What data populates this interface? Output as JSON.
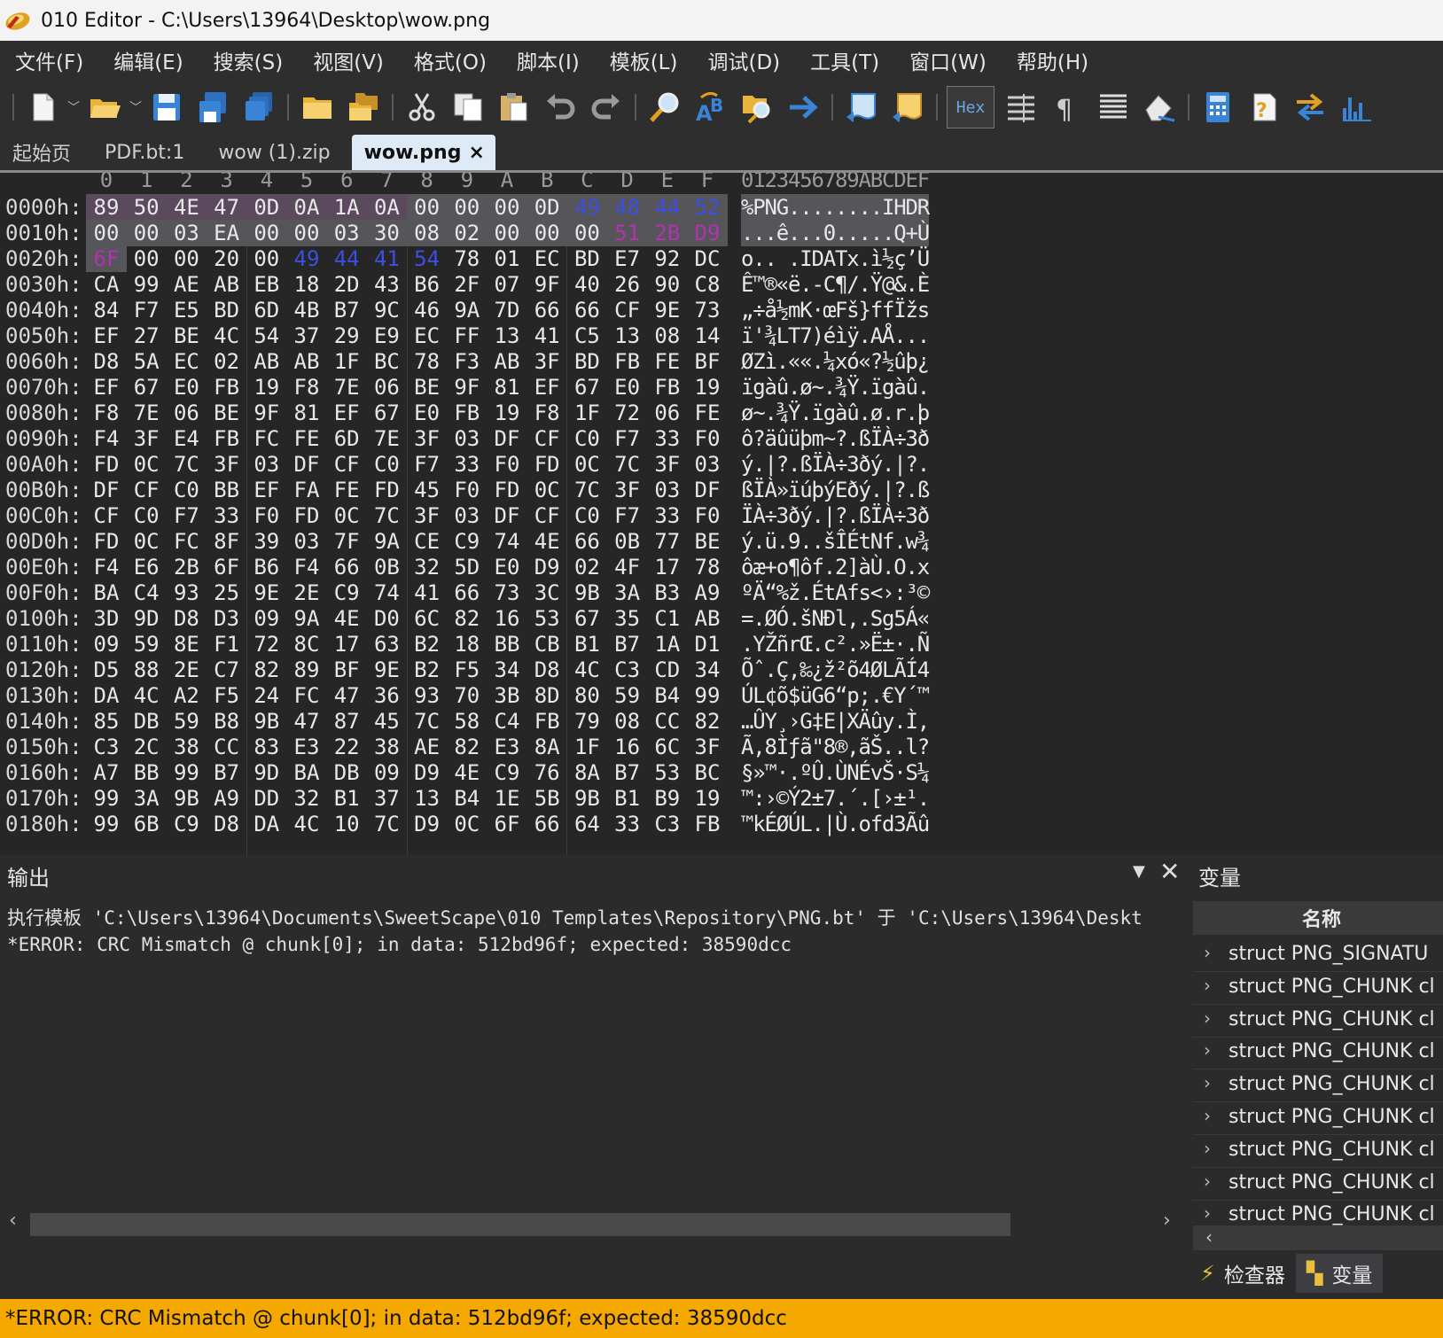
{
  "window": {
    "title": "010 Editor - C:\\Users\\13964\\Desktop\\wow.png"
  },
  "menu": [
    "文件(F)",
    "编辑(E)",
    "搜索(S)",
    "视图(V)",
    "格式(O)",
    "脚本(I)",
    "模板(L)",
    "调试(D)",
    "工具(T)",
    "窗口(W)",
    "帮助(H)"
  ],
  "toolbar": {
    "hex_label": "Hex"
  },
  "tabs": [
    {
      "label": "起始页",
      "active": false
    },
    {
      "label": "PDF.bt:1",
      "active": false
    },
    {
      "label": "wow (1).zip",
      "active": false
    },
    {
      "label": "wow.png",
      "active": true,
      "close": "×"
    }
  ],
  "hex": {
    "column_labels": [
      "0",
      "1",
      "2",
      "3",
      "4",
      "5",
      "6",
      "7",
      "8",
      "9",
      "A",
      "B",
      "C",
      "D",
      "E",
      "F"
    ],
    "ascii_header": "0123456789ABCDEF",
    "rows": [
      {
        "addr": "0000h:",
        "bytes": [
          "89",
          "50",
          "4E",
          "47",
          "0D",
          "0A",
          "1A",
          "0A",
          "00",
          "00",
          "00",
          "0D",
          "49",
          "48",
          "44",
          "52"
        ],
        "ascii": "%PNG........IHDR"
      },
      {
        "addr": "0010h:",
        "bytes": [
          "00",
          "00",
          "03",
          "EA",
          "00",
          "00",
          "03",
          "30",
          "08",
          "02",
          "00",
          "00",
          "00",
          "51",
          "2B",
          "D9"
        ],
        "ascii": "...ê...0.....Q+Ù"
      },
      {
        "addr": "0020h:",
        "bytes": [
          "6F",
          "00",
          "00",
          "20",
          "00",
          "49",
          "44",
          "41",
          "54",
          "78",
          "01",
          "EC",
          "BD",
          "E7",
          "92",
          "DC"
        ],
        "ascii": "o.. .IDATx.ì½ç’Ü"
      },
      {
        "addr": "0030h:",
        "bytes": [
          "CA",
          "99",
          "AE",
          "AB",
          "EB",
          "18",
          "2D",
          "43",
          "B6",
          "2F",
          "07",
          "9F",
          "40",
          "26",
          "90",
          "C8"
        ],
        "ascii": "Ê™®«ë.-C¶/.Ÿ@&.È"
      },
      {
        "addr": "0040h:",
        "bytes": [
          "84",
          "F7",
          "E5",
          "BD",
          "6D",
          "4B",
          "B7",
          "9C",
          "46",
          "9A",
          "7D",
          "66",
          "66",
          "CF",
          "9E",
          "73"
        ],
        "ascii": "„÷å½mK·œFš}ffÏžs"
      },
      {
        "addr": "0050h:",
        "bytes": [
          "EF",
          "27",
          "BE",
          "4C",
          "54",
          "37",
          "29",
          "E9",
          "EC",
          "FF",
          "13",
          "41",
          "C5",
          "13",
          "08",
          "14"
        ],
        "ascii": "ï'¾LT7)éìÿ.AÅ..."
      },
      {
        "addr": "0060h:",
        "bytes": [
          "D8",
          "5A",
          "EC",
          "02",
          "AB",
          "AB",
          "1F",
          "BC",
          "78",
          "F3",
          "AB",
          "3F",
          "BD",
          "FB",
          "FE",
          "BF"
        ],
        "ascii": "ØZì.««.¼xó«?½ûþ¿"
      },
      {
        "addr": "0070h:",
        "bytes": [
          "EF",
          "67",
          "E0",
          "FB",
          "19",
          "F8",
          "7E",
          "06",
          "BE",
          "9F",
          "81",
          "EF",
          "67",
          "E0",
          "FB",
          "19"
        ],
        "ascii": "ïgàû.ø~.¾Ÿ.ïgàû."
      },
      {
        "addr": "0080h:",
        "bytes": [
          "F8",
          "7E",
          "06",
          "BE",
          "9F",
          "81",
          "EF",
          "67",
          "E0",
          "FB",
          "19",
          "F8",
          "1F",
          "72",
          "06",
          "FE"
        ],
        "ascii": "ø~.¾Ÿ.ïgàû.ø.r.þ"
      },
      {
        "addr": "0090h:",
        "bytes": [
          "F4",
          "3F",
          "E4",
          "FB",
          "FC",
          "FE",
          "6D",
          "7E",
          "3F",
          "03",
          "DF",
          "CF",
          "C0",
          "F7",
          "33",
          "F0"
        ],
        "ascii": "ô?äûüþm~?.ßÏÀ÷3ð"
      },
      {
        "addr": "00A0h:",
        "bytes": [
          "FD",
          "0C",
          "7C",
          "3F",
          "03",
          "DF",
          "CF",
          "C0",
          "F7",
          "33",
          "F0",
          "FD",
          "0C",
          "7C",
          "3F",
          "03"
        ],
        "ascii": "ý.|?.ßÏÀ÷3ðý.|?."
      },
      {
        "addr": "00B0h:",
        "bytes": [
          "DF",
          "CF",
          "C0",
          "BB",
          "EF",
          "FA",
          "FE",
          "FD",
          "45",
          "F0",
          "FD",
          "0C",
          "7C",
          "3F",
          "03",
          "DF"
        ],
        "ascii": "ßÏÀ»ïúþýEðý.|?.ß"
      },
      {
        "addr": "00C0h:",
        "bytes": [
          "CF",
          "C0",
          "F7",
          "33",
          "F0",
          "FD",
          "0C",
          "7C",
          "3F",
          "03",
          "DF",
          "CF",
          "C0",
          "F7",
          "33",
          "F0"
        ],
        "ascii": "ÏÀ÷3ðý.|?.ßÏÀ÷3ð"
      },
      {
        "addr": "00D0h:",
        "bytes": [
          "FD",
          "0C",
          "FC",
          "8F",
          "39",
          "03",
          "7F",
          "9A",
          "CE",
          "C9",
          "74",
          "4E",
          "66",
          "0B",
          "77",
          "BE"
        ],
        "ascii": "ý.ü.9..šÎÉtNf.w¾"
      },
      {
        "addr": "00E0h:",
        "bytes": [
          "F4",
          "E6",
          "2B",
          "6F",
          "B6",
          "F4",
          "66",
          "0B",
          "32",
          "5D",
          "E0",
          "D9",
          "02",
          "4F",
          "17",
          "78"
        ],
        "ascii": "ôæ+o¶ôf.2]àÙ.O.x"
      },
      {
        "addr": "00F0h:",
        "bytes": [
          "BA",
          "C4",
          "93",
          "25",
          "9E",
          "2E",
          "C9",
          "74",
          "41",
          "66",
          "73",
          "3C",
          "9B",
          "3A",
          "B3",
          "A9"
        ],
        "ascii": "ºÄ“%ž.ÉtAfs<›:³©"
      },
      {
        "addr": "0100h:",
        "bytes": [
          "3D",
          "9D",
          "D8",
          "D3",
          "09",
          "9A",
          "4E",
          "D0",
          "6C",
          "82",
          "16",
          "53",
          "67",
          "35",
          "C1",
          "AB"
        ],
        "ascii": "=.ØÓ.šNÐl‚.Sg5Á«"
      },
      {
        "addr": "0110h:",
        "bytes": [
          "09",
          "59",
          "8E",
          "F1",
          "72",
          "8C",
          "17",
          "63",
          "B2",
          "18",
          "BB",
          "CB",
          "B1",
          "B7",
          "1A",
          "D1"
        ],
        "ascii": ".YŽñrŒ.c².»Ë±·.Ñ"
      },
      {
        "addr": "0120h:",
        "bytes": [
          "D5",
          "88",
          "2E",
          "C7",
          "82",
          "89",
          "BF",
          "9E",
          "B2",
          "F5",
          "34",
          "D8",
          "4C",
          "C3",
          "CD",
          "34"
        ],
        "ascii": "Õˆ.Ç‚‰¿ž²õ4ØLÃÍ4"
      },
      {
        "addr": "0130h:",
        "bytes": [
          "DA",
          "4C",
          "A2",
          "F5",
          "24",
          "FC",
          "47",
          "36",
          "93",
          "70",
          "3B",
          "8D",
          "80",
          "59",
          "B4",
          "99"
        ],
        "ascii": "ÚL¢õ$üG6“p;.€Y´™"
      },
      {
        "addr": "0140h:",
        "bytes": [
          "85",
          "DB",
          "59",
          "B8",
          "9B",
          "47",
          "87",
          "45",
          "7C",
          "58",
          "C4",
          "FB",
          "79",
          "08",
          "CC",
          "82"
        ],
        "ascii": "…ÛY¸›G‡E|XÄûy.Ì‚"
      },
      {
        "addr": "0150h:",
        "bytes": [
          "C3",
          "2C",
          "38",
          "CC",
          "83",
          "E3",
          "22",
          "38",
          "AE",
          "82",
          "E3",
          "8A",
          "1F",
          "16",
          "6C",
          "3F"
        ],
        "ascii": "Ã,8Ìƒã\"8®‚ãŠ..l?"
      },
      {
        "addr": "0160h:",
        "bytes": [
          "A7",
          "BB",
          "99",
          "B7",
          "9D",
          "BA",
          "DB",
          "09",
          "D9",
          "4E",
          "C9",
          "76",
          "8A",
          "B7",
          "53",
          "BC"
        ],
        "ascii": "§»™·.ºÛ.ÙNÉvŠ·S¼"
      },
      {
        "addr": "0170h:",
        "bytes": [
          "99",
          "3A",
          "9B",
          "A9",
          "DD",
          "32",
          "B1",
          "37",
          "13",
          "B4",
          "1E",
          "5B",
          "9B",
          "B1",
          "B9",
          "19"
        ],
        "ascii": "™:›©Ý2±7.´.[›±¹."
      },
      {
        "addr": "0180h:",
        "bytes": [
          "99",
          "6B",
          "C9",
          "D8",
          "DA",
          "4C",
          "10",
          "7C",
          "D9",
          "0C",
          "6F",
          "66",
          "64",
          "33",
          "C3",
          "FB"
        ],
        "ascii": "™kÉØÚL.|Ù.ofd3Ãû"
      }
    ]
  },
  "output": {
    "title": "输出",
    "lines": [
      "执行模板 'C:\\Users\\13964\\Documents\\SweetScape\\010 Templates\\Repository\\PNG.bt' 于 'C:\\Users\\13964\\Deskt",
      "*ERROR: CRC Mismatch @ chunk[0]; in data: 512bd96f; expected: 38590dcc"
    ]
  },
  "variables": {
    "title": "变量",
    "column": "名称",
    "rows": [
      "struct PNG_SIGNATU",
      "struct PNG_CHUNK cl",
      "struct PNG_CHUNK cl",
      "struct PNG_CHUNK cl",
      "struct PNG_CHUNK cl",
      "struct PNG_CHUNK cl",
      "struct PNG_CHUNK cl",
      "struct PNG_CHUNK cl",
      "struct PNG_CHUNK cl"
    ]
  },
  "panel_tabs": [
    {
      "label": "检查器",
      "icon": "bolt-icon",
      "active": false
    },
    {
      "label": "变量",
      "icon": "variables-icon",
      "active": true
    }
  ],
  "status": {
    "message": "*ERROR: CRC Mismatch @ chunk[0]; in data: 512bd96f; expected: 38590dcc"
  }
}
